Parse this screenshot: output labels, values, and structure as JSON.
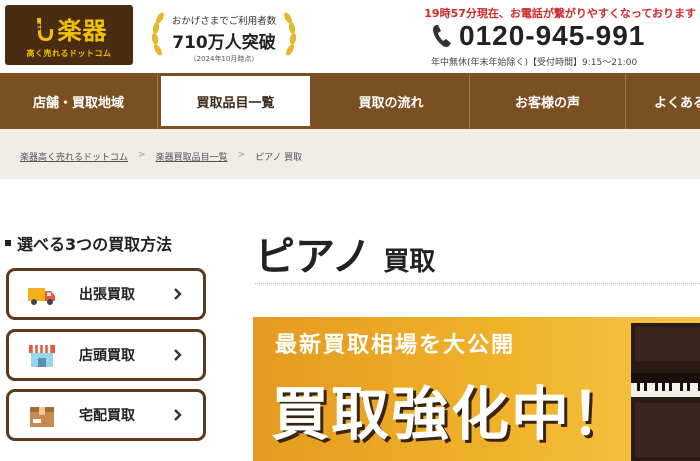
{
  "header": {
    "logo_name": "楽器",
    "logo_tagline": "高く売れるドットコム",
    "award_line1": "おかげさまでご利用者数",
    "award_line2": "710万人突破",
    "award_line3": "（2024年10月時点）",
    "notice": "19時57分現在、お電話が繋がりやすくなっております",
    "phone": "0120-945-991",
    "hours": "年中無休(年末年始除く)【受付時間】9:15～21:00"
  },
  "nav": {
    "items": [
      {
        "label": "店舗・買取地域"
      },
      {
        "label": "買取品目一覧"
      },
      {
        "label": "買取の流れ"
      },
      {
        "label": "お客様の声"
      },
      {
        "label": "よくある"
      }
    ]
  },
  "breadcrumb": {
    "items": [
      "楽器高く売れるドットコム",
      "楽器買取品目一覧",
      "ピアノ 買取"
    ],
    "separator": ">"
  },
  "sidebar": {
    "title": "選べる3つの買取方法",
    "methods": [
      {
        "label": "出張買取",
        "icon": "truck-icon"
      },
      {
        "label": "店頭買取",
        "icon": "shop-icon"
      },
      {
        "label": "宅配買取",
        "icon": "box-icon"
      }
    ]
  },
  "main": {
    "title": "ピアノ",
    "title_suffix": "買取",
    "banner_sub": "最新買取相場を大公開",
    "banner_main": "買取強化中！"
  },
  "colors": {
    "brand_brown": "#7a4f22",
    "logo_bg": "#4a2c12",
    "logo_text": "#f2c200",
    "notice_red": "#d12a2a",
    "banner_orange": "#f0b22a"
  }
}
